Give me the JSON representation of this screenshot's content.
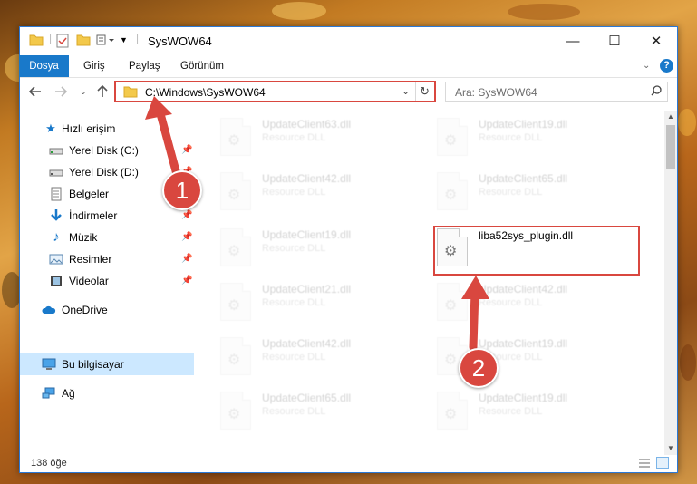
{
  "window": {
    "title": "SysWOW64"
  },
  "window_controls": {
    "minimize": "—",
    "maximize": "☐",
    "close": "✕"
  },
  "ribbon": {
    "tabs": [
      "Dosya",
      "Giriş",
      "Paylaş",
      "Görünüm"
    ]
  },
  "address_bar": {
    "path": "C:\\Windows\\SysWOW64"
  },
  "search": {
    "placeholder": "Ara: SysWOW64"
  },
  "sidebar": {
    "items": [
      {
        "label": "Hızlı erişim",
        "icon": "star-icon",
        "pinned": false
      },
      {
        "label": "Yerel Disk (C:)",
        "icon": "drive-icon",
        "pinned": true
      },
      {
        "label": "Yerel Disk (D:)",
        "icon": "drive-icon",
        "pinned": true
      },
      {
        "label": "Belgeler",
        "icon": "documents-icon",
        "pinned": true
      },
      {
        "label": "İndirmeler",
        "icon": "downloads-icon",
        "pinned": true
      },
      {
        "label": "Müzik",
        "icon": "music-icon",
        "pinned": true
      },
      {
        "label": "Resimler",
        "icon": "pictures-icon",
        "pinned": true
      },
      {
        "label": "Videolar",
        "icon": "videos-icon",
        "pinned": true
      },
      {
        "label": "OneDrive",
        "icon": "cloud-icon",
        "pinned": false
      },
      {
        "label": "Bu bilgisayar",
        "icon": "computer-icon",
        "pinned": false,
        "selected": true
      },
      {
        "label": "Ağ",
        "icon": "network-icon",
        "pinned": false
      }
    ]
  },
  "files": [
    {
      "name": "UpdateClient63.dll",
      "type": "Resource DLL",
      "faded": true
    },
    {
      "name": "UpdateClient19.dll",
      "type": "Resource DLL",
      "faded": true
    },
    {
      "name": "UpdateClient42.dll",
      "type": "Resource DLL",
      "faded": true
    },
    {
      "name": "UpdateClient65.dll",
      "type": "Resource DLL",
      "faded": true
    },
    {
      "name": "UpdateClient19.dll",
      "type": "Resource DLL",
      "faded": true
    },
    {
      "name": "liba52sys_plugin.dll",
      "type": "",
      "faded": false
    },
    {
      "name": "UpdateClient21.dll",
      "type": "Resource DLL",
      "faded": true
    },
    {
      "name": "UpdateClient42.dll",
      "type": "Resource DLL",
      "faded": true
    },
    {
      "name": "UpdateClient42.dll",
      "type": "Resource DLL",
      "faded": true
    },
    {
      "name": "UpdateClient19.dll",
      "type": "Resource DLL",
      "faded": true
    },
    {
      "name": "UpdateClient65.dll",
      "type": "Resource DLL",
      "faded": true
    },
    {
      "name": "UpdateClient19.dll",
      "type": "Resource DLL",
      "faded": true
    }
  ],
  "status": {
    "item_count": "138 öğe"
  },
  "annotations": {
    "marker1": "1",
    "marker2": "2",
    "color": "#d9473f"
  }
}
